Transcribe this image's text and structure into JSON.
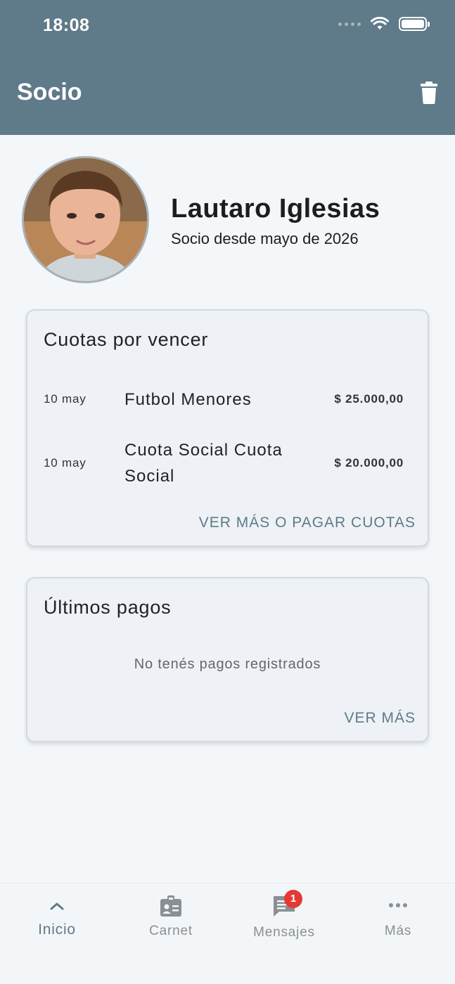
{
  "status_bar": {
    "time": "18:08"
  },
  "header": {
    "title": "Socio",
    "delete_icon": "trash-icon"
  },
  "profile": {
    "name": "Lautaro Iglesias",
    "since": "Socio desde mayo de 2026"
  },
  "dues": {
    "title": "Cuotas por vencer",
    "items": [
      {
        "date": "10 may",
        "description": "Futbol Menores",
        "amount": "$ 25.000,00"
      },
      {
        "date": "10 may",
        "description": "Cuota Social Cuota Social",
        "amount": "$ 20.000,00"
      }
    ],
    "link_label": "VER MÁS O PAGAR CUOTAS"
  },
  "payments": {
    "title": "Últimos pagos",
    "empty_message": "No tenés pagos registrados",
    "link_label": "VER MÁS"
  },
  "tabbar": {
    "tabs": [
      {
        "label": "Inicio",
        "icon": "chevron-up-icon",
        "active": true
      },
      {
        "label": "Carnet",
        "icon": "id-badge-icon",
        "active": false
      },
      {
        "label": "Mensajes",
        "icon": "message-icon",
        "active": false,
        "badge": "1"
      },
      {
        "label": "Más",
        "icon": "more-icon",
        "active": false
      }
    ]
  },
  "colors": {
    "primary": "#5f7a89",
    "background": "#f4f7fa",
    "card": "#eef2f6",
    "badge": "#e53935"
  }
}
